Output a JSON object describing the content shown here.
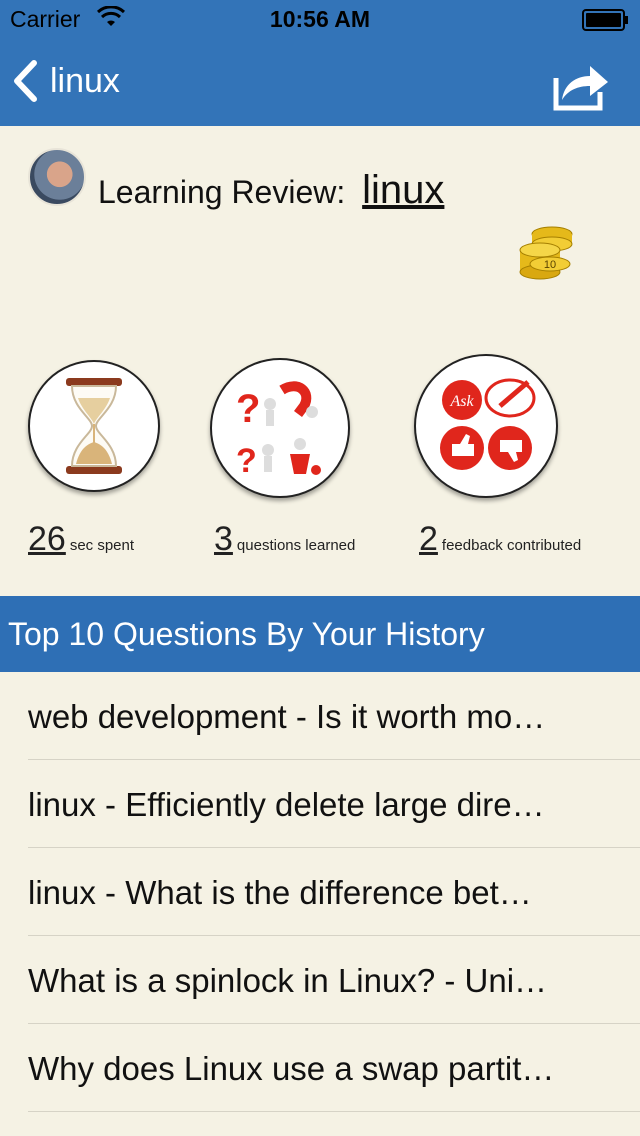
{
  "status_bar": {
    "carrier": "Carrier",
    "time": "10:56 AM"
  },
  "nav": {
    "back_label": "linux",
    "share_icon": "share-icon"
  },
  "review": {
    "title_prefix": "Learning Review:",
    "topic": "linux",
    "coins": "10"
  },
  "stats": [
    {
      "value": "26",
      "unit": "sec spent",
      "icon": "hourglass-icon"
    },
    {
      "value": "3",
      "unit": "questions learned",
      "icon": "questions-icon"
    },
    {
      "value": "2",
      "unit": "feedback contributed",
      "icon": "feedback-icon"
    }
  ],
  "section": {
    "title": "Top 10 Questions By Your History"
  },
  "questions": [
    "web development - Is it worth mo…",
    "linux - Efficiently delete large dire…",
    "linux - What is the difference bet…",
    "What is a spinlock in Linux? - Uni…",
    "Why does Linux use a swap partit…"
  ],
  "colors": {
    "nav_bg": "#3374b8",
    "section_bg": "#2e6fb5",
    "page_bg": "#f5f2e4",
    "accent_red": "#e0261c"
  }
}
